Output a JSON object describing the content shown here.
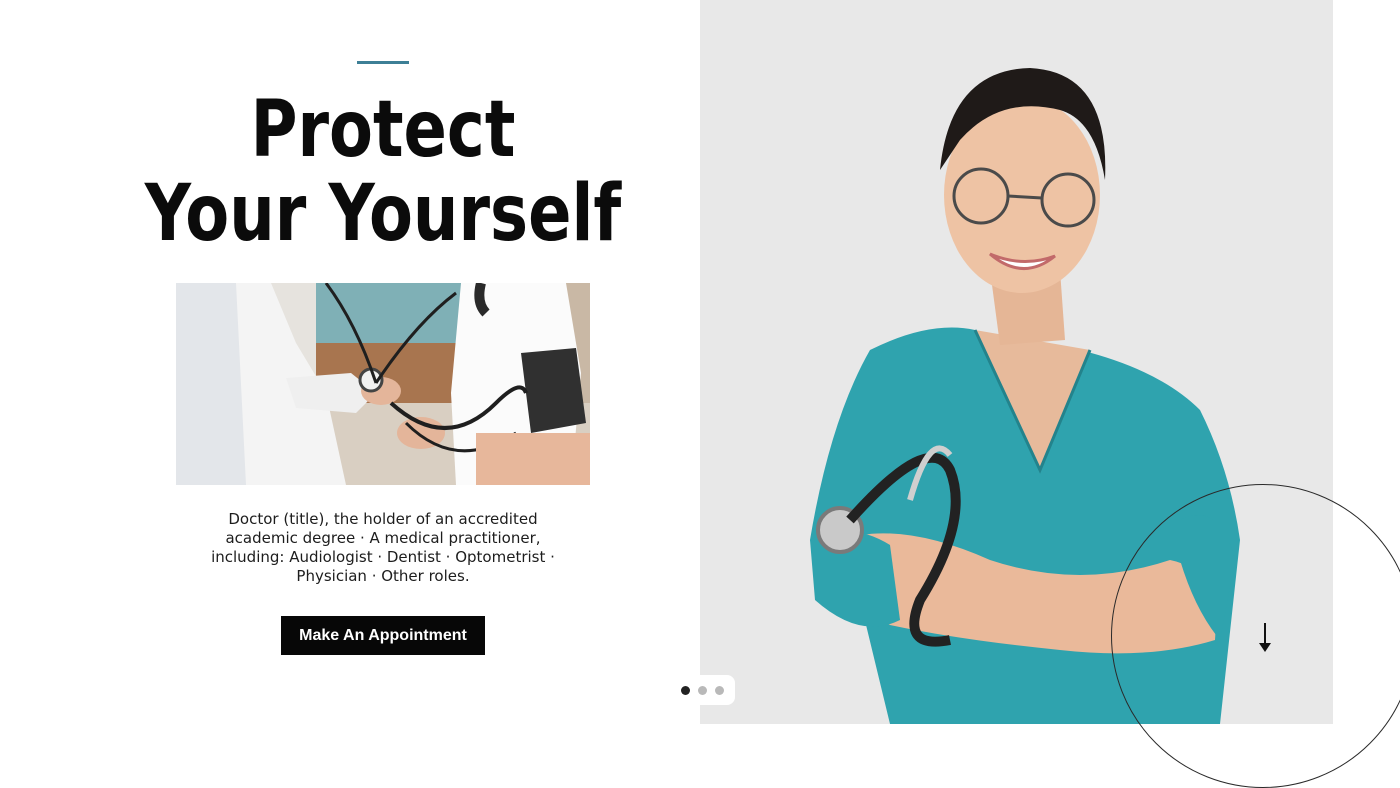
{
  "hero": {
    "headline_line1": "Protect",
    "headline_line2": "Your Yourself",
    "description": "Doctor (title), the holder of an accredited academic degree · A medical practitioner, including: Audiologist · Dentist · Optometrist · Physician · Other roles.",
    "cta_label": "Make An Appointment"
  },
  "slider": {
    "slide_count": 3,
    "active_index": 0
  },
  "icons": {
    "scroll": "down-arrow-icon",
    "ring": "circle-outline"
  },
  "colors": {
    "accent": "#3d7f96",
    "button_bg": "#070707",
    "scrubs": "#2fa3ae",
    "right_bg": "#e8e8e8"
  }
}
